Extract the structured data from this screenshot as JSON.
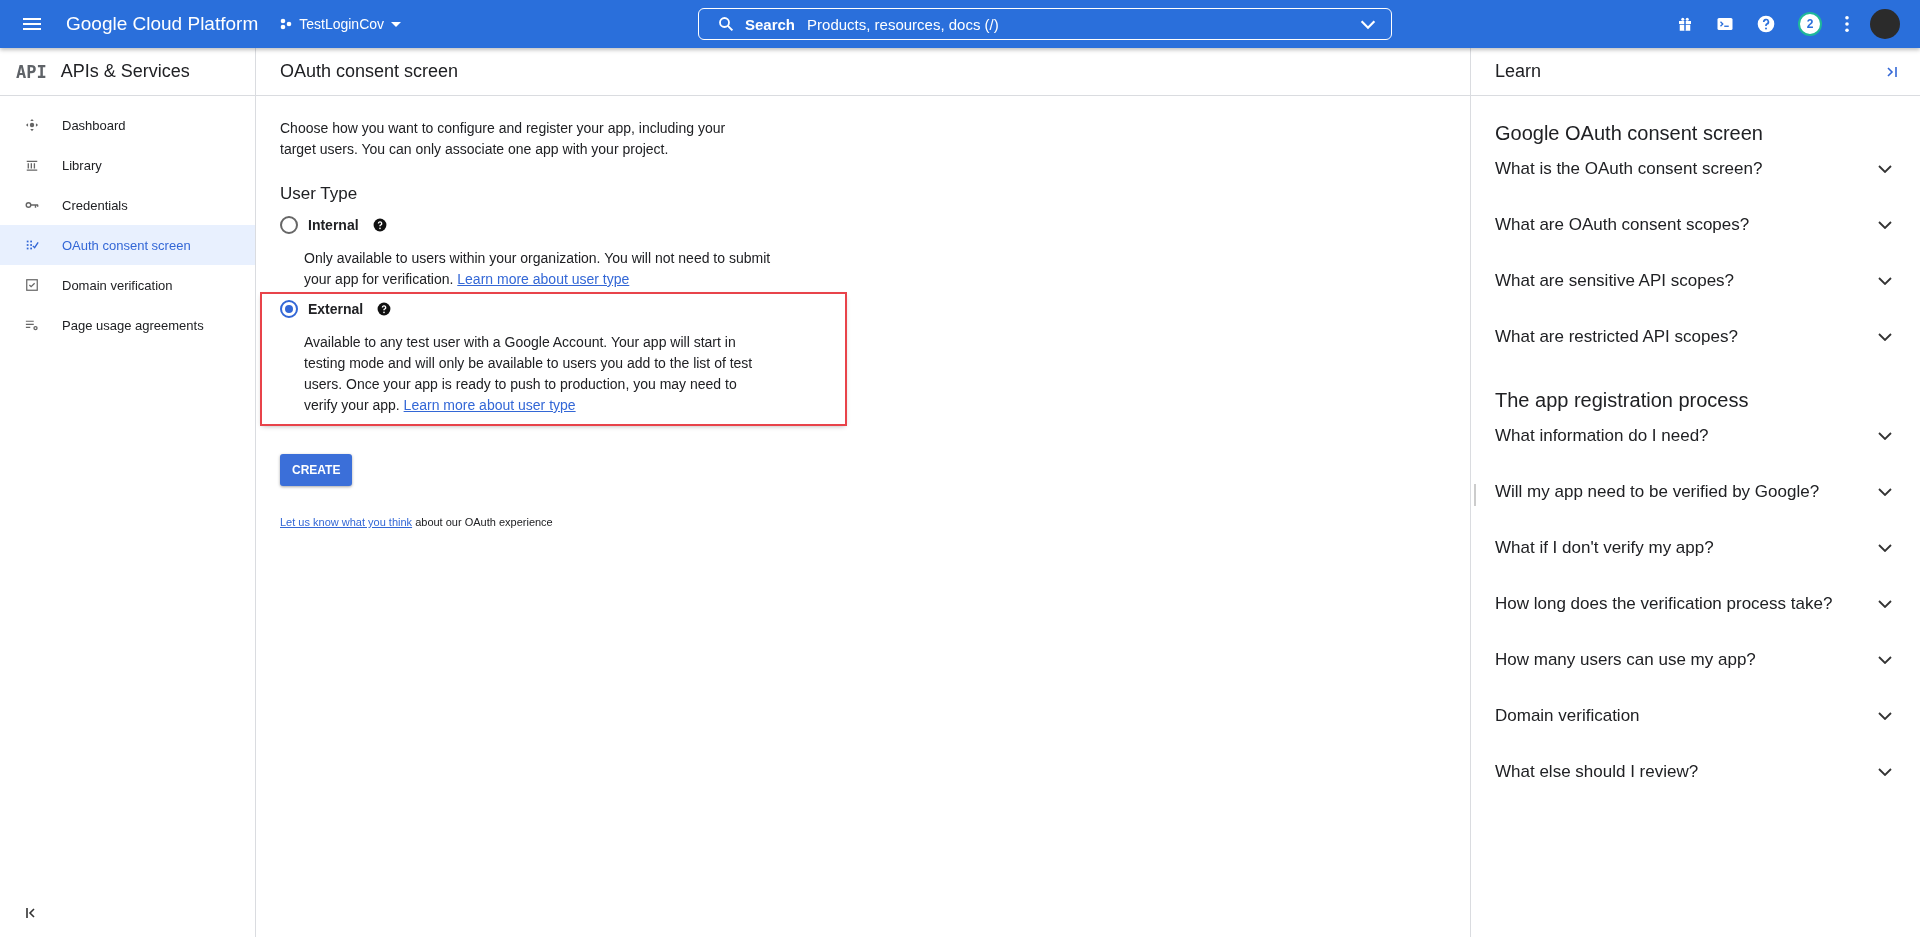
{
  "top_bar": {
    "product": "Google Cloud Platform",
    "project": "TestLoginCov",
    "search": {
      "label": "Search",
      "placeholder": "Products, resources, docs (/)"
    },
    "notification_count": "2"
  },
  "sidebar": {
    "logo": "API",
    "title": "APIs & Services",
    "items": [
      {
        "label": "Dashboard",
        "selected": false
      },
      {
        "label": "Library",
        "selected": false
      },
      {
        "label": "Credentials",
        "selected": false
      },
      {
        "label": "OAuth consent screen",
        "selected": true
      },
      {
        "label": "Domain verification",
        "selected": false
      },
      {
        "label": "Page usage agreements",
        "selected": false
      }
    ]
  },
  "main": {
    "title": "OAuth consent screen",
    "intro": "Choose how you want to configure and register your app, including your target users. You can only associate one app with your project.",
    "section_title": "User Type",
    "options": [
      {
        "label": "Internal",
        "selected": false,
        "highlighted": false,
        "description": "Only available to users within your organization. You will not need to submit your app for verification.",
        "link": "Learn more about user type"
      },
      {
        "label": "External",
        "selected": true,
        "highlighted": true,
        "description": "Available to any test user with a Google Account. Your app will start in testing mode and will only be available to users you add to the list of test users. Once your app is ready to push to production, you may need to verify your app.",
        "link": "Learn more about user type"
      }
    ],
    "create_button": "CREATE",
    "feedback_link": "Let us know what you think",
    "feedback_text": "about our OAuth experience"
  },
  "learn_panel": {
    "title": "Learn",
    "sections": [
      {
        "title": "Google OAuth consent screen",
        "items": [
          {
            "label": "What is the OAuth consent screen?",
            "expanded": false
          },
          {
            "label": "What are OAuth consent scopes?",
            "expanded": false
          },
          {
            "label": "What are sensitive API scopes?",
            "expanded": false
          },
          {
            "label": "What are restricted API scopes?",
            "expanded": false
          }
        ]
      },
      {
        "title": "The app registration process",
        "items": [
          {
            "label": "What information do I need?",
            "expanded": false
          },
          {
            "label": "Will my app need to be verified by Google?",
            "expanded": false
          },
          {
            "label": "What if I don't verify my app?",
            "expanded": false
          },
          {
            "label": "How long does the verification process take?",
            "expanded": false
          },
          {
            "label": "How many users can use my app?",
            "expanded": false
          },
          {
            "label": "Domain verification",
            "expanded": false
          },
          {
            "label": "What else should I review?",
            "expanded": false
          }
        ]
      }
    ]
  }
}
